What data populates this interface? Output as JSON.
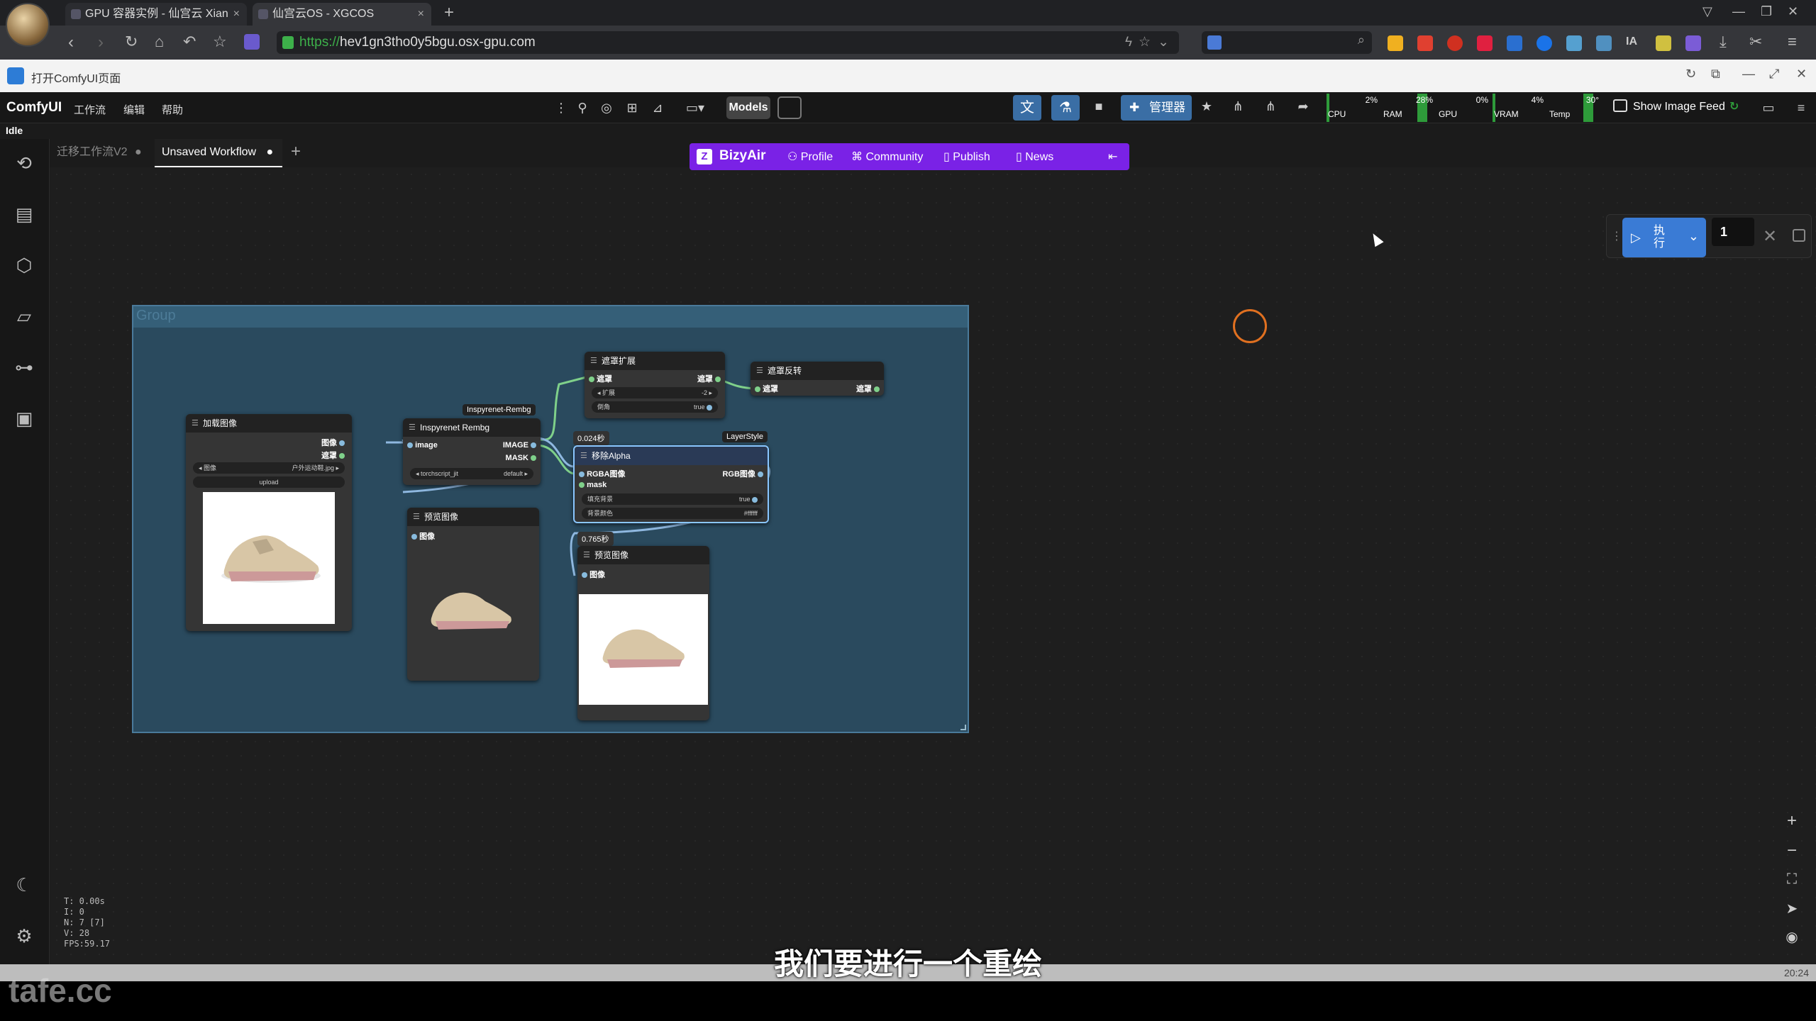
{
  "browser": {
    "tabs": [
      {
        "title": "GPU 容器实例 - 仙宫云 Xian"
      },
      {
        "title": "仙宫云OS - XGCOS"
      }
    ],
    "url_protocol": "https://",
    "url_rest": "hev1gn3tho0y5bgu.osx-gpu.com",
    "infobar_text": "打开ComfyUI页面"
  },
  "comfy": {
    "logo": "ComfyUI",
    "menu": [
      "工作流",
      "编辑",
      "帮助"
    ],
    "models_label": "Models",
    "manager_label": "管理器",
    "metrics": [
      {
        "label": "CPU",
        "value": "2%",
        "level": 0.02
      },
      {
        "label": "RAM",
        "value": "28%",
        "level": 0.28
      },
      {
        "label": "GPU",
        "value": "0%",
        "level": 0
      },
      {
        "label": "VRAM",
        "value": "4%",
        "level": 0.04
      },
      {
        "label": "Temp",
        "value": "30°",
        "level": 0.3
      }
    ],
    "show_image_feed": "Show Image Feed",
    "status": "Idle",
    "workflow_tabs": [
      {
        "label": "迁移工作流V2"
      },
      {
        "label": "Unsaved Workflow"
      }
    ]
  },
  "bizyair": {
    "title": "BizyAir",
    "items": [
      "Profile",
      "Community",
      "Publish",
      "News"
    ]
  },
  "run_panel": {
    "run_label": "执行",
    "batch_count": "1"
  },
  "group": {
    "title": "Group"
  },
  "nodes": {
    "load_image": {
      "title": "加载图像",
      "out_image": "图像",
      "out_mask": "遮罩",
      "widget_label": "图像",
      "widget_value": "户外运动鞋.jpg",
      "upload": "upload"
    },
    "inspyrenet": {
      "badge": "Inspyrenet-Rembg",
      "title": "Inspyrenet Rembg",
      "in_image": "image",
      "out_image": "IMAGE",
      "out_mask": "MASK",
      "widget_value": "torchscript_jit",
      "widget_default": "default"
    },
    "preview1": {
      "title": "预览图像",
      "in_image": "图像"
    },
    "mask_expand": {
      "title": "遮罩扩展",
      "in_mask": "遮罩",
      "out_mask": "遮罩",
      "w1_label": "扩展",
      "w1_value": "-2",
      "w2_label": "倒角",
      "w2_value": "true"
    },
    "mask_invert": {
      "title": "遮罩反转",
      "in_mask": "遮罩",
      "out_mask": "遮罩"
    },
    "remove_alpha": {
      "time": "0.024秒",
      "badge": "LayerStyle",
      "title": "移除Alpha",
      "in_rgba": "RGBA图像",
      "in_mask": "mask",
      "out_rgb": "RGB图像",
      "w1_label": "填充背景",
      "w1_value": "true",
      "w2_label": "背景颜色",
      "w2_value": "#ffffff"
    },
    "preview2": {
      "time": "0.765秒",
      "title": "预览图像",
      "in_image": "图像"
    }
  },
  "stats": [
    "T: 0.00s",
    "I: 0",
    "N: 7 [7]",
    "V: 28",
    "FPS:59.17"
  ],
  "subtitle": "我们要进行一个重绘",
  "bottom_time": "20:24",
  "watermark": "tafe.cc",
  "colors": {
    "accent_blue": "#3a6ea5",
    "bizyair_purple": "#7a22e6",
    "metric_green": "#2e9b3a",
    "group_bg": "#2a4a5e"
  }
}
